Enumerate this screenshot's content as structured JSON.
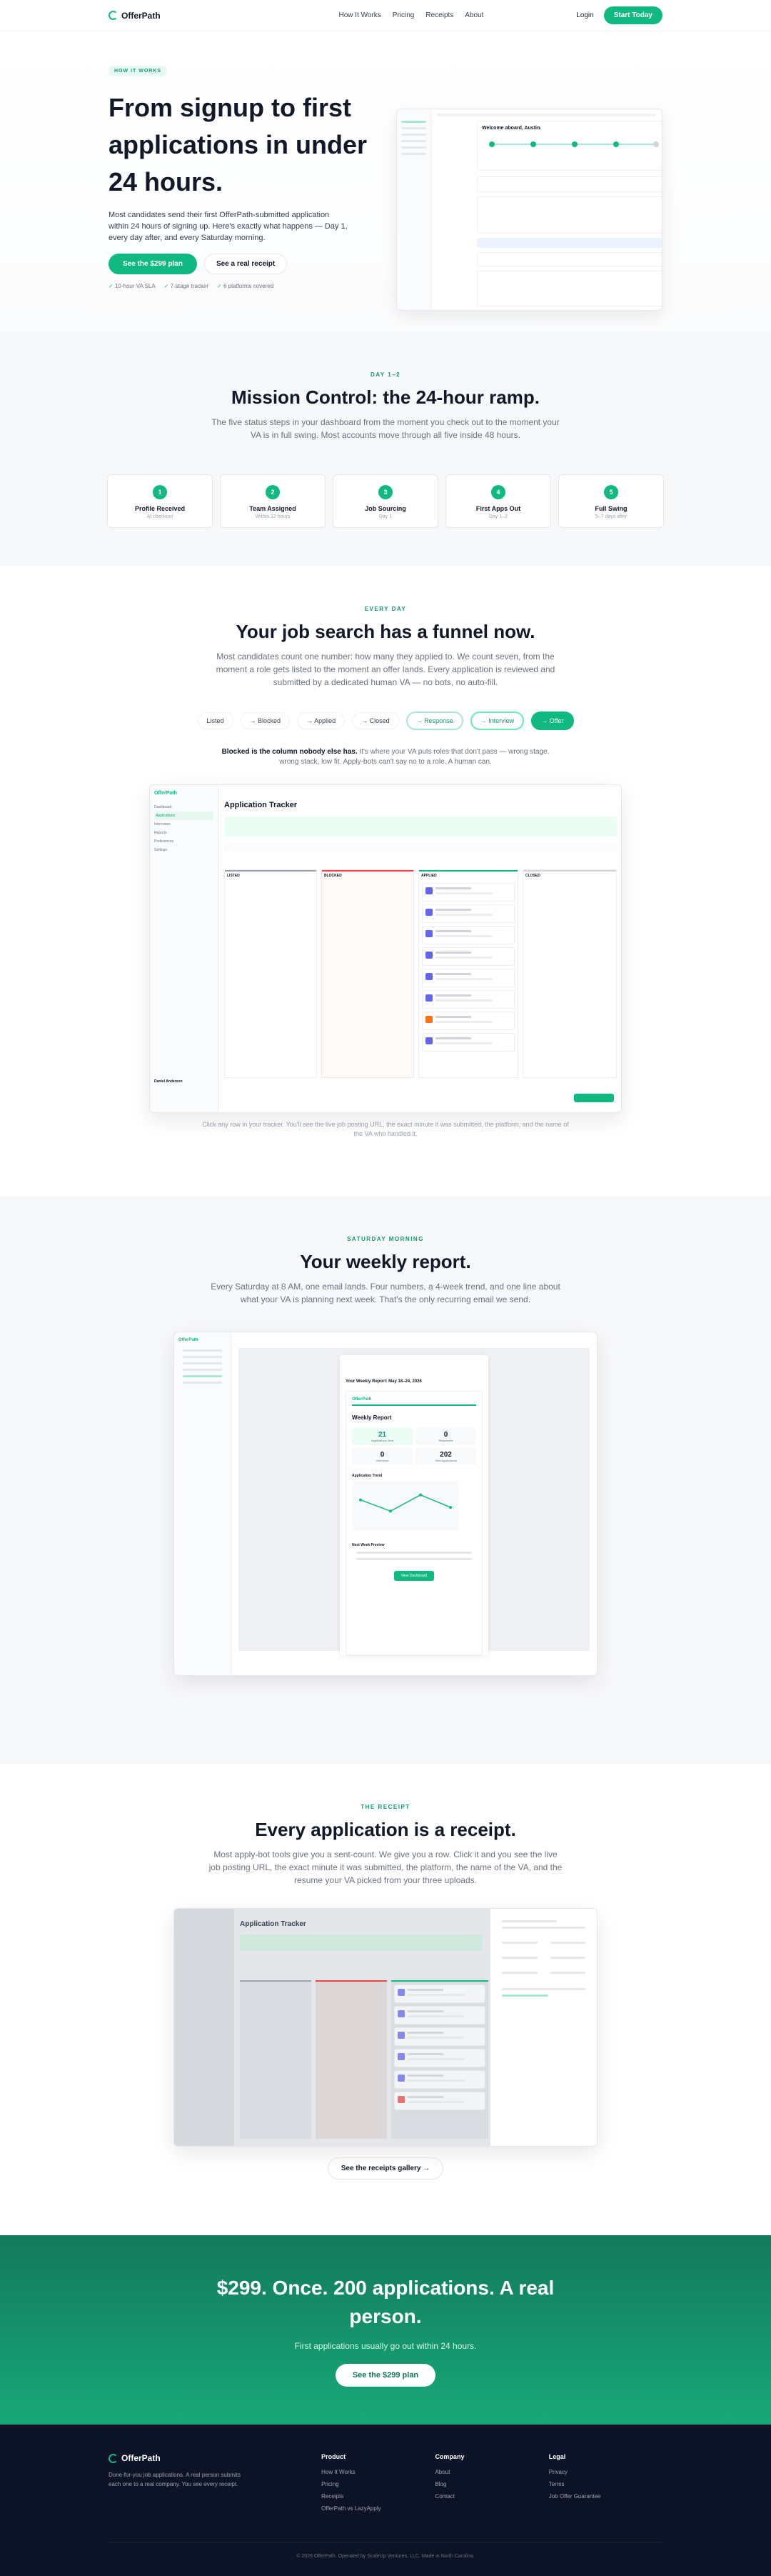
{
  "nav": {
    "brand": "OfferPath",
    "links": [
      "How It Works",
      "Pricing",
      "Receipts",
      "About"
    ],
    "login": "Login",
    "cta": "Start Today"
  },
  "hero": {
    "eyebrow": "HOW IT WORKS",
    "title": "From signup to first applications in under 24 hours.",
    "subtitle": "Most candidates send their first OfferPath-submitted application within 24 hours of signing up. Here's exactly what happens — Day 1, every day after, and every Saturday morning.",
    "primary_btn": "See the $299 plan",
    "secondary_btn": "See a real receipt",
    "checks": [
      "10-hour VA SLA",
      "7-stage tracker",
      "6 platforms covered"
    ],
    "mock_welcome": "Welcome aboard, Austin."
  },
  "mission": {
    "eyebrow": "DAY 1–2",
    "title": "Mission Control: the 24-hour ramp.",
    "subtitle": "The five status steps in your dashboard from the moment you check out to the moment your VA is in full swing. Most accounts move through all five inside 48 hours.",
    "steps": [
      {
        "num": "1",
        "title": "Profile Received",
        "desc": "At checkout"
      },
      {
        "num": "2",
        "title": "Team Assigned",
        "desc": "Within 12 hours"
      },
      {
        "num": "3",
        "title": "Job Sourcing",
        "desc": "Day 1"
      },
      {
        "num": "4",
        "title": "First Apps Out",
        "desc": "Day 1–2"
      },
      {
        "num": "5",
        "title": "Full Swing",
        "desc": "5–7 days after"
      }
    ]
  },
  "funnel": {
    "eyebrow": "EVERY DAY",
    "title": "Your job search has a funnel now.",
    "subtitle": "Most candidates count one number: how many they applied to. We count seven, from the moment a role gets listed to the moment an offer lands. Every application is reviewed and submitted by a dedicated human VA — no bots, no auto-fill.",
    "chips": [
      "Listed",
      "→ Blocked",
      "→ Applied",
      "→ Closed",
      "→ Response",
      "→ Interview",
      "→ Offer"
    ],
    "note_bold": "Blocked is the column nobody else has.",
    "note_rest": " It's where your VA puts roles that don't pass — wrong stage, wrong stack, low fit. Apply-bots can't say no to a role. A human can.",
    "caption": "Click any row in your tracker. You'll see the live job posting URL, the exact minute it was submitted, the platform, and the name of the VA who handled it.",
    "tracker_title": "Application Tracker",
    "columns": [
      "LISTED",
      "BLOCKED",
      "APPLIED",
      "CLOSED"
    ],
    "brand": "OfferPath",
    "side_items": [
      "Dashboard",
      "Applications",
      "Interviews",
      "Reports",
      "Preferences",
      "Settings"
    ],
    "user_name": "Daniel Anderson"
  },
  "weekly": {
    "eyebrow": "SATURDAY MORNING",
    "title": "Your weekly report.",
    "subtitle": "Every Saturday at 8 AM, one email lands. Four numbers, a 4-week trend, and one line about what your VA is planning next week. That's the only recurring email we send.",
    "email_subject": "Your Weekly Report: May 18–24, 2026",
    "report_title": "Weekly Report",
    "stats": [
      {
        "value": "21",
        "label": "Applications Sent"
      },
      {
        "value": "0",
        "label": "Responses"
      },
      {
        "value": "0",
        "label": "Interviews"
      },
      {
        "value": "202",
        "label": "Total Applications"
      }
    ],
    "trend_label": "Application Trend",
    "trend_values": [
      18,
      9,
      22,
      12
    ],
    "next_week_label": "Next Week Preview",
    "button": "View Dashboard",
    "brand": "OfferPath"
  },
  "receipt": {
    "eyebrow": "THE RECEIPT",
    "title": "Every application is a receipt.",
    "subtitle": "Most apply-bot tools give you a sent-count. We give you a row. Click it and you see the live job posting URL, the exact minute it was submitted, the platform, the name of the VA, and the resume your VA picked from your three uploads.",
    "button": "See the receipts gallery →",
    "tracker_title": "Application Tracker"
  },
  "cta": {
    "title": "$299. Once. 200 applications. A real person.",
    "subtitle": "First applications usually go out within 24 hours.",
    "button": "See the $299 plan"
  },
  "footer": {
    "brand": "OfferPath",
    "tagline": "Done-for-you job applications. A real person submits each one to a real company. You see every receipt.",
    "columns": [
      {
        "title": "Product",
        "links": [
          "How It Works",
          "Pricing",
          "Receipts",
          "OfferPath vs LazyApply"
        ]
      },
      {
        "title": "Company",
        "links": [
          "About",
          "Blog",
          "Contact"
        ]
      },
      {
        "title": "Legal",
        "links": [
          "Privacy",
          "Terms",
          "Job Offer Guarantee"
        ]
      }
    ],
    "copyright": "© 2026 OfferPath. Operated by ScaleUp Ventures, LLC. Made in North Carolina."
  },
  "colors": {
    "accent": "#10b981",
    "dark": "#0c1326",
    "cta_band": "#137a5c"
  }
}
